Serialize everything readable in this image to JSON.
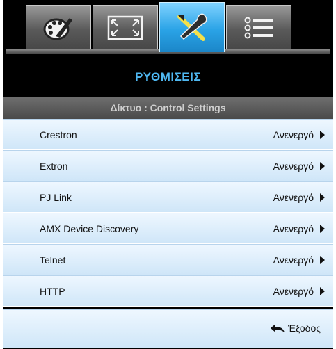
{
  "tabs": [
    {
      "name": "image",
      "icon": "palette-brush-icon",
      "active": false
    },
    {
      "name": "display",
      "icon": "expand-screen-icon",
      "active": false
    },
    {
      "name": "setup",
      "icon": "tools-icon",
      "active": true
    },
    {
      "name": "options",
      "icon": "list-options-icon",
      "active": false
    }
  ],
  "menu_title": "ΡΥΘΜΙΣΕΙΣ",
  "submenu_title": "Δίκτυο : Control Settings",
  "rows": [
    {
      "label": "Crestron",
      "value": "Ανενεργό"
    },
    {
      "label": "Extron",
      "value": "Ανενεργό"
    },
    {
      "label": "PJ Link",
      "value": "Ανενεργό"
    },
    {
      "label": "AMX Device Discovery",
      "value": "Ανενεργό"
    },
    {
      "label": "Telnet",
      "value": "Ανενεργό"
    },
    {
      "label": "HTTP",
      "value": "Ανενεργό"
    }
  ],
  "exit_label": "Έξοδος",
  "colors": {
    "accent": "#4fb7f0",
    "active_tab": "#2aa3e6"
  }
}
